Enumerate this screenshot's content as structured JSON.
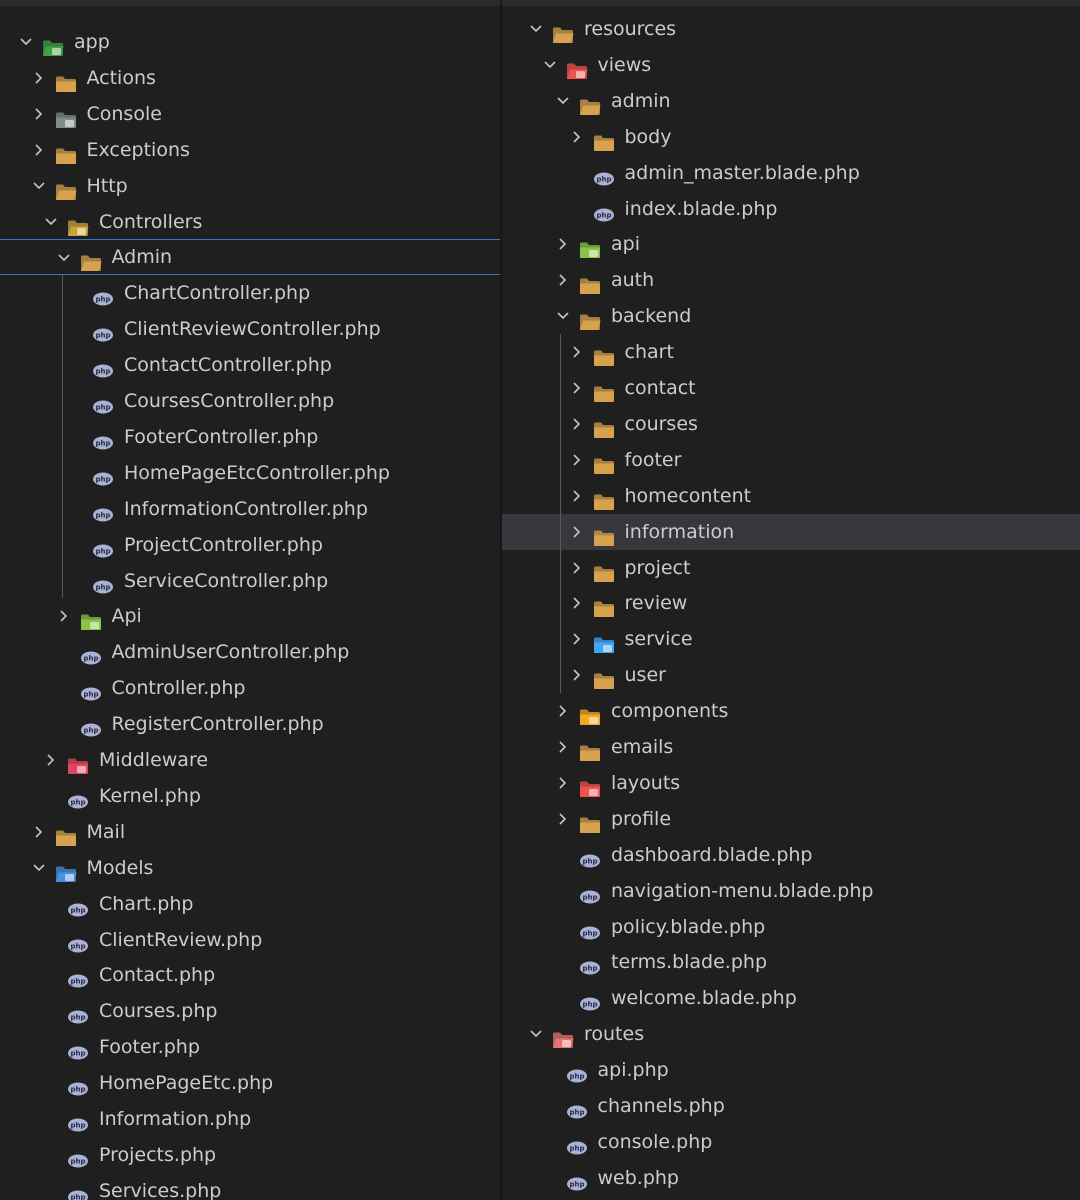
{
  "left_tree": [
    {
      "label": "app",
      "depth": 0,
      "kind": "folder",
      "expanded": true,
      "icon": "folder-app-icon",
      "color": "#4caf50"
    },
    {
      "label": "Actions",
      "depth": 1,
      "kind": "folder",
      "expanded": false,
      "icon": "folder-icon"
    },
    {
      "label": "Console",
      "depth": 1,
      "kind": "folder",
      "expanded": false,
      "icon": "folder-console-icon"
    },
    {
      "label": "Exceptions",
      "depth": 1,
      "kind": "folder",
      "expanded": false,
      "icon": "folder-icon"
    },
    {
      "label": "Http",
      "depth": 1,
      "kind": "folder",
      "expanded": true,
      "icon": "folder-icon"
    },
    {
      "label": "Controllers",
      "depth": 2,
      "kind": "folder",
      "expanded": true,
      "icon": "folder-controllers-icon"
    },
    {
      "label": "Admin",
      "depth": 3,
      "kind": "folder",
      "expanded": true,
      "icon": "folder-icon",
      "selected": true
    },
    {
      "label": "ChartController.php",
      "depth": 4,
      "kind": "file",
      "icon": "php-file-icon"
    },
    {
      "label": "ClientReviewController.php",
      "depth": 4,
      "kind": "file",
      "icon": "php-file-icon"
    },
    {
      "label": "ContactController.php",
      "depth": 4,
      "kind": "file",
      "icon": "php-file-icon"
    },
    {
      "label": "CoursesController.php",
      "depth": 4,
      "kind": "file",
      "icon": "php-file-icon"
    },
    {
      "label": "FooterController.php",
      "depth": 4,
      "kind": "file",
      "icon": "php-file-icon"
    },
    {
      "label": "HomePageEtcController.php",
      "depth": 4,
      "kind": "file",
      "icon": "php-file-icon"
    },
    {
      "label": "InformationController.php",
      "depth": 4,
      "kind": "file",
      "icon": "php-file-icon"
    },
    {
      "label": "ProjectController.php",
      "depth": 4,
      "kind": "file",
      "icon": "php-file-icon"
    },
    {
      "label": "ServiceController.php",
      "depth": 4,
      "kind": "file",
      "icon": "php-file-icon"
    },
    {
      "label": "Api",
      "depth": 3,
      "kind": "folder",
      "expanded": false,
      "icon": "folder-api-icon"
    },
    {
      "label": "AdminUserController.php",
      "depth": 3,
      "kind": "file",
      "icon": "php-file-icon"
    },
    {
      "label": "Controller.php",
      "depth": 3,
      "kind": "file",
      "icon": "php-file-icon"
    },
    {
      "label": "RegisterController.php",
      "depth": 3,
      "kind": "file",
      "icon": "php-file-icon"
    },
    {
      "label": "Middleware",
      "depth": 2,
      "kind": "folder",
      "expanded": false,
      "icon": "folder-middleware-icon"
    },
    {
      "label": "Kernel.php",
      "depth": 2,
      "kind": "file",
      "icon": "php-file-icon"
    },
    {
      "label": "Mail",
      "depth": 1,
      "kind": "folder",
      "expanded": false,
      "icon": "folder-icon"
    },
    {
      "label": "Models",
      "depth": 1,
      "kind": "folder",
      "expanded": true,
      "icon": "folder-models-icon"
    },
    {
      "label": "Chart.php",
      "depth": 2,
      "kind": "file",
      "icon": "php-file-icon"
    },
    {
      "label": "ClientReview.php",
      "depth": 2,
      "kind": "file",
      "icon": "php-file-icon"
    },
    {
      "label": "Contact.php",
      "depth": 2,
      "kind": "file",
      "icon": "php-file-icon"
    },
    {
      "label": "Courses.php",
      "depth": 2,
      "kind": "file",
      "icon": "php-file-icon"
    },
    {
      "label": "Footer.php",
      "depth": 2,
      "kind": "file",
      "icon": "php-file-icon"
    },
    {
      "label": "HomePageEtc.php",
      "depth": 2,
      "kind": "file",
      "icon": "php-file-icon"
    },
    {
      "label": "Information.php",
      "depth": 2,
      "kind": "file",
      "icon": "php-file-icon"
    },
    {
      "label": "Projects.php",
      "depth": 2,
      "kind": "file",
      "icon": "php-file-icon"
    },
    {
      "label": "Services.php",
      "depth": 2,
      "kind": "file",
      "icon": "php-file-icon"
    }
  ],
  "right_tree": [
    {
      "label": "resources",
      "depth": 0,
      "kind": "folder",
      "expanded": true,
      "icon": "folder-icon"
    },
    {
      "label": "views",
      "depth": 1,
      "kind": "folder",
      "expanded": true,
      "icon": "folder-views-icon"
    },
    {
      "label": "admin",
      "depth": 2,
      "kind": "folder",
      "expanded": true,
      "icon": "folder-icon"
    },
    {
      "label": "body",
      "depth": 3,
      "kind": "folder",
      "expanded": false,
      "icon": "folder-icon"
    },
    {
      "label": "admin_master.blade.php",
      "depth": 3,
      "kind": "file",
      "icon": "php-file-icon"
    },
    {
      "label": "index.blade.php",
      "depth": 3,
      "kind": "file",
      "icon": "php-file-icon"
    },
    {
      "label": "api",
      "depth": 2,
      "kind": "folder",
      "expanded": false,
      "icon": "folder-api-icon"
    },
    {
      "label": "auth",
      "depth": 2,
      "kind": "folder",
      "expanded": false,
      "icon": "folder-icon"
    },
    {
      "label": "backend",
      "depth": 2,
      "kind": "folder",
      "expanded": true,
      "icon": "folder-icon"
    },
    {
      "label": "chart",
      "depth": 3,
      "kind": "folder",
      "expanded": false,
      "icon": "folder-icon"
    },
    {
      "label": "contact",
      "depth": 3,
      "kind": "folder",
      "expanded": false,
      "icon": "folder-icon"
    },
    {
      "label": "courses",
      "depth": 3,
      "kind": "folder",
      "expanded": false,
      "icon": "folder-icon"
    },
    {
      "label": "footer",
      "depth": 3,
      "kind": "folder",
      "expanded": false,
      "icon": "folder-icon"
    },
    {
      "label": "homecontent",
      "depth": 3,
      "kind": "folder",
      "expanded": false,
      "icon": "folder-icon"
    },
    {
      "label": "information",
      "depth": 3,
      "kind": "folder",
      "expanded": false,
      "icon": "folder-icon",
      "hover": true
    },
    {
      "label": "project",
      "depth": 3,
      "kind": "folder",
      "expanded": false,
      "icon": "folder-icon"
    },
    {
      "label": "review",
      "depth": 3,
      "kind": "folder",
      "expanded": false,
      "icon": "folder-icon"
    },
    {
      "label": "service",
      "depth": 3,
      "kind": "folder",
      "expanded": false,
      "icon": "folder-service-icon"
    },
    {
      "label": "user",
      "depth": 3,
      "kind": "folder",
      "expanded": false,
      "icon": "folder-icon"
    },
    {
      "label": "components",
      "depth": 2,
      "kind": "folder",
      "expanded": false,
      "icon": "folder-components-icon"
    },
    {
      "label": "emails",
      "depth": 2,
      "kind": "folder",
      "expanded": false,
      "icon": "folder-icon"
    },
    {
      "label": "layouts",
      "depth": 2,
      "kind": "folder",
      "expanded": false,
      "icon": "folder-layouts-icon"
    },
    {
      "label": "profile",
      "depth": 2,
      "kind": "folder",
      "expanded": false,
      "icon": "folder-icon"
    },
    {
      "label": "dashboard.blade.php",
      "depth": 2,
      "kind": "file",
      "icon": "php-file-icon"
    },
    {
      "label": "navigation-menu.blade.php",
      "depth": 2,
      "kind": "file",
      "icon": "php-file-icon"
    },
    {
      "label": "policy.blade.php",
      "depth": 2,
      "kind": "file",
      "icon": "php-file-icon"
    },
    {
      "label": "terms.blade.php",
      "depth": 2,
      "kind": "file",
      "icon": "php-file-icon"
    },
    {
      "label": "welcome.blade.php",
      "depth": 2,
      "kind": "file",
      "icon": "php-file-icon"
    },
    {
      "label": "routes",
      "depth": 0,
      "kind": "folder",
      "expanded": true,
      "icon": "folder-routes-icon"
    },
    {
      "label": "api.php",
      "depth": 1,
      "kind": "file",
      "icon": "php-file-icon"
    },
    {
      "label": "channels.php",
      "depth": 1,
      "kind": "file",
      "icon": "php-file-icon"
    },
    {
      "label": "console.php",
      "depth": 1,
      "kind": "file",
      "icon": "php-file-icon"
    },
    {
      "label": "web.php",
      "depth": 1,
      "kind": "file",
      "icon": "php-file-icon"
    }
  ],
  "colors": {
    "folder": "#d6a24e",
    "folder_dark": "#b9852e",
    "app": "#43a047",
    "console": "#7f8c8d",
    "controllers": "#c9a33a",
    "api": "#8bc34a",
    "middleware": "#e0455e",
    "models": "#4a90e2",
    "views": "#ef5350",
    "service": "#42a5f5",
    "components": "#f5a623",
    "layouts": "#ef5350",
    "routes": "#e57373",
    "php": "#a9b1d6",
    "selection": "#2b79d0",
    "hover": "#37373d"
  }
}
